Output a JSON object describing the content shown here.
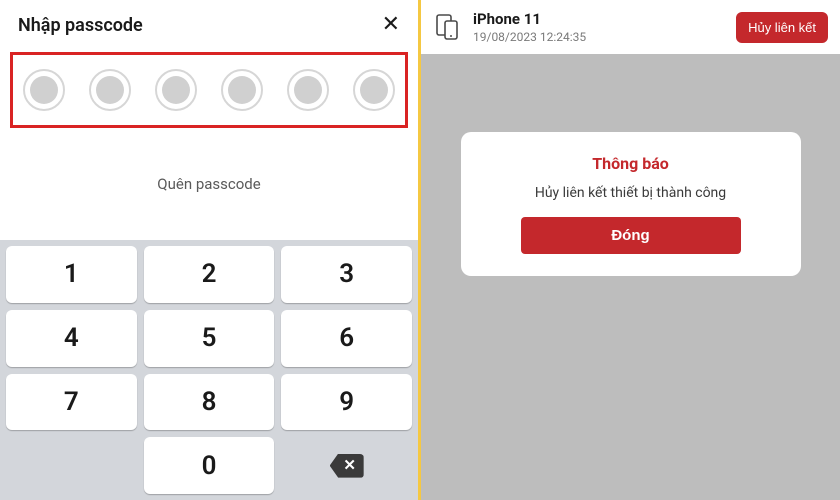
{
  "left": {
    "title": "Nhập passcode",
    "forgot": "Quên passcode",
    "keys": {
      "k1": "1",
      "k2": "2",
      "k3": "3",
      "k4": "4",
      "k5": "5",
      "k6": "6",
      "k7": "7",
      "k8": "8",
      "k9": "9",
      "k0": "0"
    },
    "passcode_length": 6
  },
  "right": {
    "device": {
      "name": "iPhone 11",
      "timestamp": "19/08/2023 12:24:35"
    },
    "unlink_label": "Hủy liên kết",
    "modal": {
      "title": "Thông báo",
      "message": "Hủy liên kết thiết bị thành công",
      "close_label": "Đóng"
    }
  },
  "colors": {
    "accent_red": "#c4282c",
    "highlight_border": "#d92323",
    "divider": "#f5c842"
  }
}
